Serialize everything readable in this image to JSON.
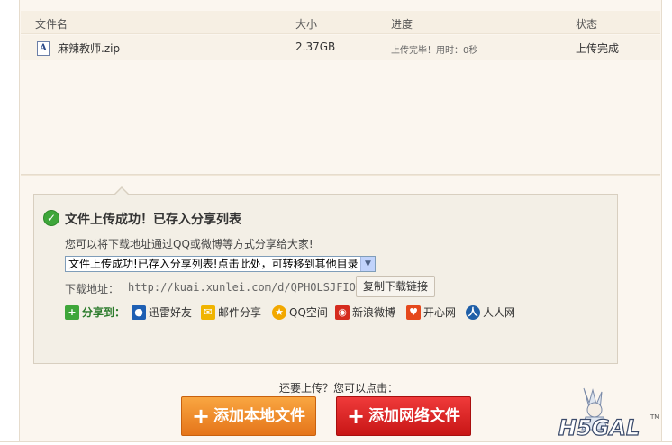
{
  "table": {
    "headers": {
      "filename": "文件名",
      "size": "大小",
      "progress": "进度",
      "status": "状态"
    },
    "rows": [
      {
        "icon": "text-file-icon",
        "icon_glyph": "A",
        "filename": "麻辣教师.zip",
        "size": "2.37GB",
        "progress": "上传完毕！用时：0秒",
        "status": "上传完成"
      }
    ]
  },
  "share_panel": {
    "title": "文件上传成功！已存入分享列表",
    "hint": "您可以将下载地址通过QQ或微博等方式分享给大家!",
    "folder_select": "文件上传成功!已存入分享列表!点击此处，可转移到其他目录",
    "download_label": "下载地址：",
    "download_url": "http://kuai.xunlei.com/d/QPHOLSJFIOQA",
    "copy_button": "复制下载链接",
    "share_to_label": "分享到：",
    "share_targets": [
      {
        "icon": "xunlei-friends-icon",
        "label": "迅雷好友",
        "color": "#1e5fb3"
      },
      {
        "icon": "mail-icon",
        "label": "邮件分享",
        "color": "#f0b400"
      },
      {
        "icon": "qzone-icon",
        "label": "QQ空间",
        "color": "#f2a800"
      },
      {
        "icon": "sina-weibo-icon",
        "label": "新浪微博",
        "color": "#d52b1e"
      },
      {
        "icon": "kaixin-icon",
        "label": "开心网",
        "color": "#e5481c"
      },
      {
        "icon": "renren-icon",
        "label": "人人网",
        "color": "#1f5fa8"
      }
    ]
  },
  "upload_more": {
    "prompt": "还要上传？您可以点击：",
    "local_button": "添加本地文件",
    "net_button": "添加网络文件"
  },
  "watermark": {
    "text": "H5GAL",
    "tm": "TM"
  },
  "colors": {
    "success": "#3ea63a",
    "local_button": "#f08c2a",
    "net_button": "#dc2020"
  }
}
